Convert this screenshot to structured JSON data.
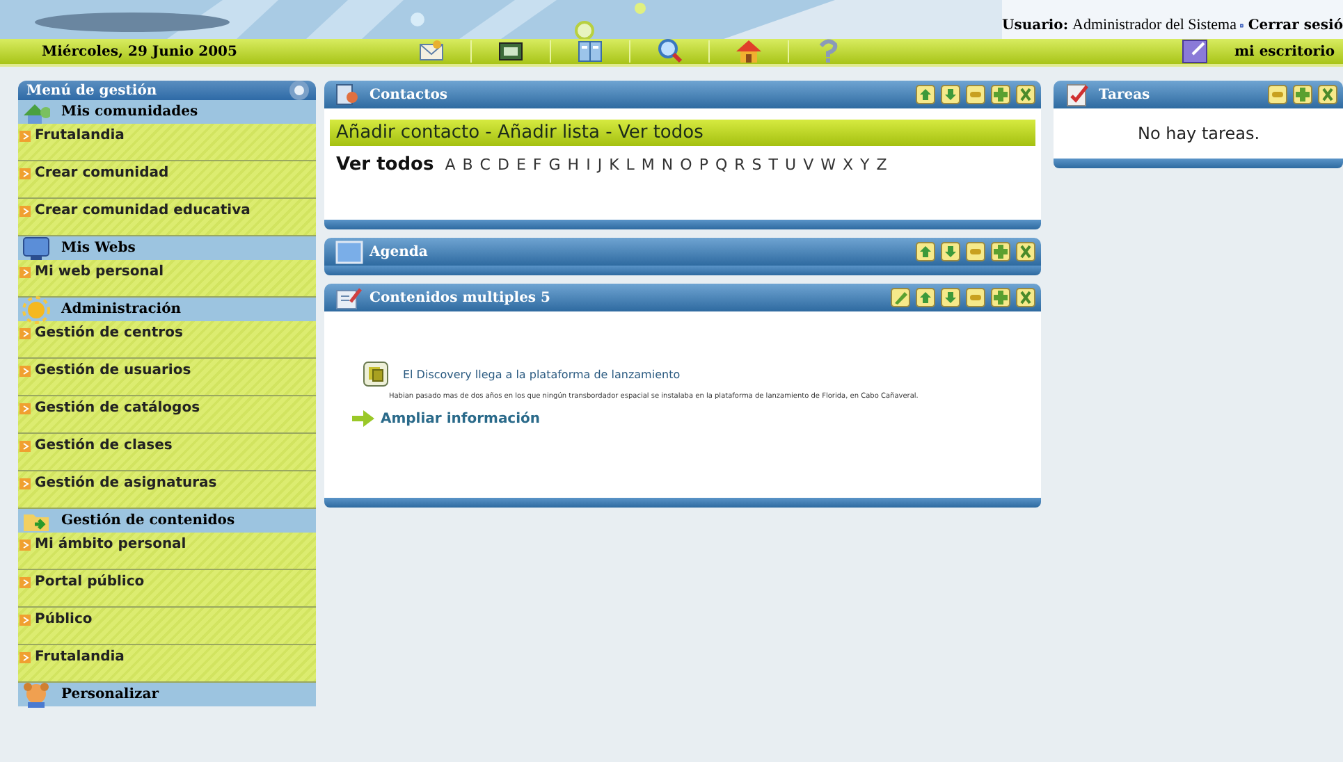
{
  "header": {
    "user_label": "Usuario:",
    "user_name": "Administrador del Sistema",
    "logout": "Cerrar sesió"
  },
  "toolbar": {
    "date": "Miércoles, 29 Junio 2005",
    "icons": [
      {
        "kind": "mail"
      },
      {
        "kind": "card"
      },
      {
        "kind": "book"
      },
      {
        "kind": "search"
      },
      {
        "kind": "home"
      },
      {
        "kind": "help"
      }
    ],
    "desk": "mi escritorio"
  },
  "sidebar": {
    "title": "Menú de gestión",
    "sections": [
      {
        "title": "Mis comunidades",
        "kind": "community",
        "items": [
          "Frutalandia",
          "Crear comunidad",
          "Crear comunidad educativa"
        ]
      },
      {
        "title": "Mis Webs",
        "kind": "monitor",
        "items": [
          "Mi web personal"
        ]
      },
      {
        "title": "Administración",
        "kind": "sun",
        "items": [
          "Gestión de centros",
          "Gestión de usuarios",
          "Gestión de catálogos",
          "Gestión de clases",
          "Gestión de asignaturas"
        ]
      },
      {
        "title": "Gestión de contenidos",
        "kind": "folder",
        "items": [
          "Mi ámbito personal",
          "Portal público",
          "Público",
          "Frutalandia"
        ]
      },
      {
        "title": "Personalizar",
        "kind": "face"
      }
    ]
  },
  "panels": [
    {
      "title": "Contactos",
      "kind": "contacts",
      "controls": [
        {
          "kind": "up"
        },
        {
          "kind": "down"
        },
        {
          "kind": "minimize"
        },
        {
          "kind": "add"
        },
        {
          "kind": "close"
        }
      ],
      "actions": [
        "Añadir contacto",
        " - ",
        "Añadir lista",
        " - ",
        "Ver todos"
      ],
      "filter_label": "Ver todos",
      "letters": [
        "A",
        "B",
        "C",
        "D",
        "E",
        "F",
        "G",
        "H",
        "I",
        "J",
        "K",
        "L",
        "M",
        "N",
        "O",
        "P",
        "Q",
        "R",
        "S",
        "T",
        "U",
        "V",
        "W",
        "X",
        "Y",
        "Z"
      ]
    },
    {
      "title": "Agenda",
      "kind": "agenda",
      "controls": [
        {
          "kind": "up"
        },
        {
          "kind": "down"
        },
        {
          "kind": "minimize"
        },
        {
          "kind": "add"
        },
        {
          "kind": "close"
        }
      ]
    },
    {
      "title": "Contenidos multiples 5",
      "kind": "content",
      "controls": [
        {
          "kind": "edit"
        },
        {
          "kind": "up"
        },
        {
          "kind": "down"
        },
        {
          "kind": "minimize"
        },
        {
          "kind": "add"
        },
        {
          "kind": "close"
        }
      ],
      "article": {
        "title": "El Discovery llega a la plataforma de lanzamiento",
        "summary": "Habian pasado mas de dos años en los que ningún transbordador espacial se instalaba en la plataforma de lanzamiento de Florida, en Cabo Cañaveral.",
        "more": "Ampliar información"
      }
    }
  ],
  "tasks": {
    "title": "Tareas",
    "controls": [
      {
        "kind": "minimize"
      },
      {
        "kind": "add"
      },
      {
        "kind": "close"
      }
    ],
    "empty": "No hay tareas."
  }
}
